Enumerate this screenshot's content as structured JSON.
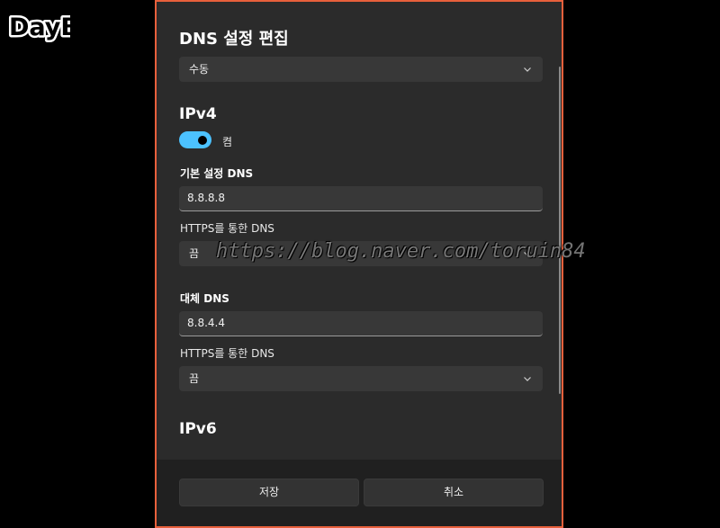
{
  "logo": {
    "text": "DayB"
  },
  "dialog": {
    "title": "DNS 설정 편집",
    "mode_select": {
      "value": "수동",
      "icon": "chevron-down-icon"
    },
    "ipv4": {
      "heading": "IPv4",
      "toggle": {
        "state": "on",
        "label": "켬",
        "color": "#4cc2ff"
      },
      "preferred": {
        "label": "기본 설정 DNS",
        "value": "8.8.8.8",
        "https_label": "HTTPS를 통한 DNS",
        "https_value": "끔"
      },
      "alternate": {
        "label": "대체 DNS",
        "value": "8.8.4.4",
        "https_label": "HTTPS를 통한 DNS",
        "https_value": "끔"
      }
    },
    "ipv6": {
      "heading": "IPv6"
    },
    "footer": {
      "save_label": "저장",
      "cancel_label": "취소"
    }
  },
  "watermark": "https://blog.naver.com/toruin84",
  "colors": {
    "highlight_border": "#e8603c",
    "accent": "#4cc2ff"
  }
}
